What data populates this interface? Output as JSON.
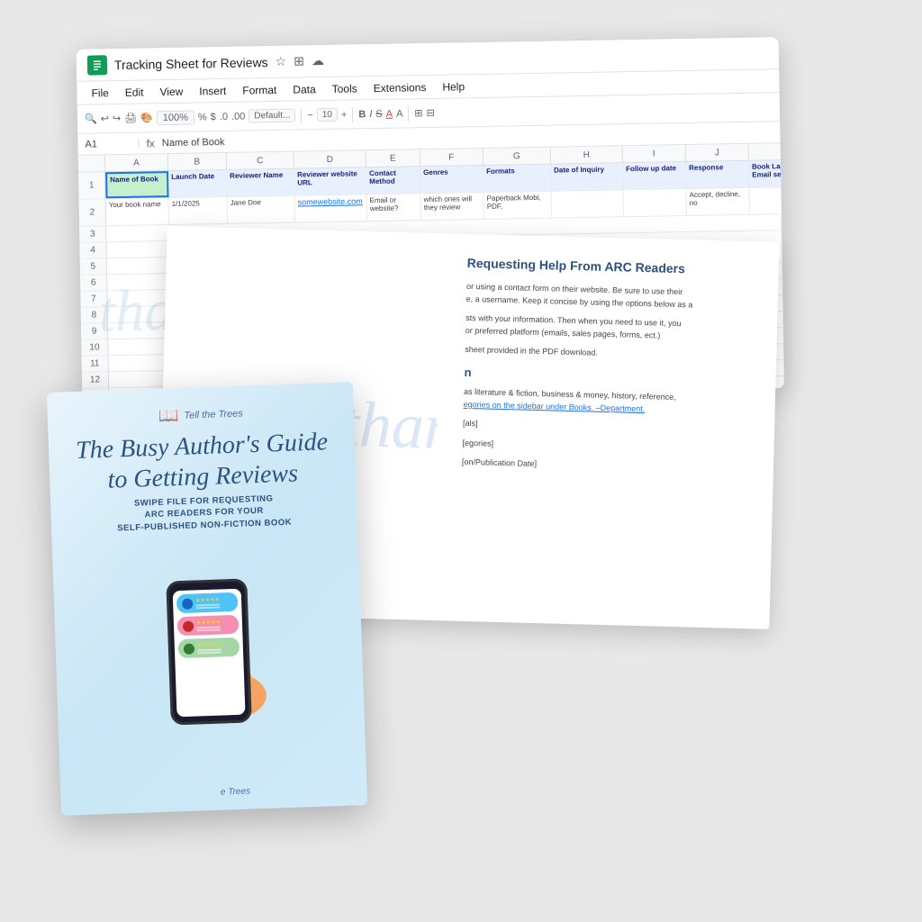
{
  "scene": {
    "background": "#e0e0e0"
  },
  "sheets": {
    "title": "Tracking Sheet for Reviews",
    "cell_ref": "A1",
    "formula": "Name of Book",
    "menu_items": [
      "File",
      "Edit",
      "View",
      "Insert",
      "Format",
      "Data",
      "Tools",
      "Extensions",
      "Help"
    ],
    "zoom": "100%",
    "columns": [
      "A",
      "B",
      "C",
      "D",
      "E",
      "F",
      "G",
      "H",
      "I",
      "J",
      "K"
    ],
    "col_headers": [
      "Name of Book",
      "Launch Date",
      "Reviewer Name",
      "Reviewer website URL",
      "Contact Method",
      "Genres",
      "Formats",
      "Date of Inquiry",
      "Follow up date",
      "Response",
      "Book Launch Date Email sent?"
    ],
    "row2": [
      "Your book name",
      "1/1/2025",
      "Jane Doe",
      "somewebsite.com",
      "Email or website?",
      "which ones will they review",
      "Paperback Mobi, PDF,",
      "",
      "",
      "Accept, decline, no",
      ""
    ],
    "watermark": "thank you"
  },
  "thankyou_page": {
    "heading": "Requesting Help From ARC Readers",
    "watermark": "thank you",
    "body_lines": [
      "or using a contact form on their website. Be sure to use their",
      "e, a username. Keep it concise by using the options below as a",
      "sts with your information. Then when you need to use it, you",
      "or preferred platform (emails, sales pages, forms, ect.)",
      "sheet provided in the PDF download.",
      "",
      "n",
      "",
      "as literature & fiction, business & money, history, reference,",
      "egories on the sidebar under Books. -Department.",
      "",
      "[als]",
      "[egories]",
      "[on/Publication Date]"
    ]
  },
  "book_cover": {
    "logo_text": "Tell the Trees",
    "title_line1": "The Busy Author's Guide",
    "title_line2": "to Getting Reviews",
    "subtitle": "SWIPE FILE FOR REQUESTING\nARC READERS FOR YOUR\nSELF-PUBLISHED NON-FICTION BOOK",
    "brand": "e Trees",
    "chat_bubbles": [
      {
        "color": "blue",
        "stars": "★★★★★"
      },
      {
        "color": "pink",
        "stars": "★★★★★"
      },
      {
        "color": "green",
        "stars": "★★★★★"
      }
    ]
  }
}
